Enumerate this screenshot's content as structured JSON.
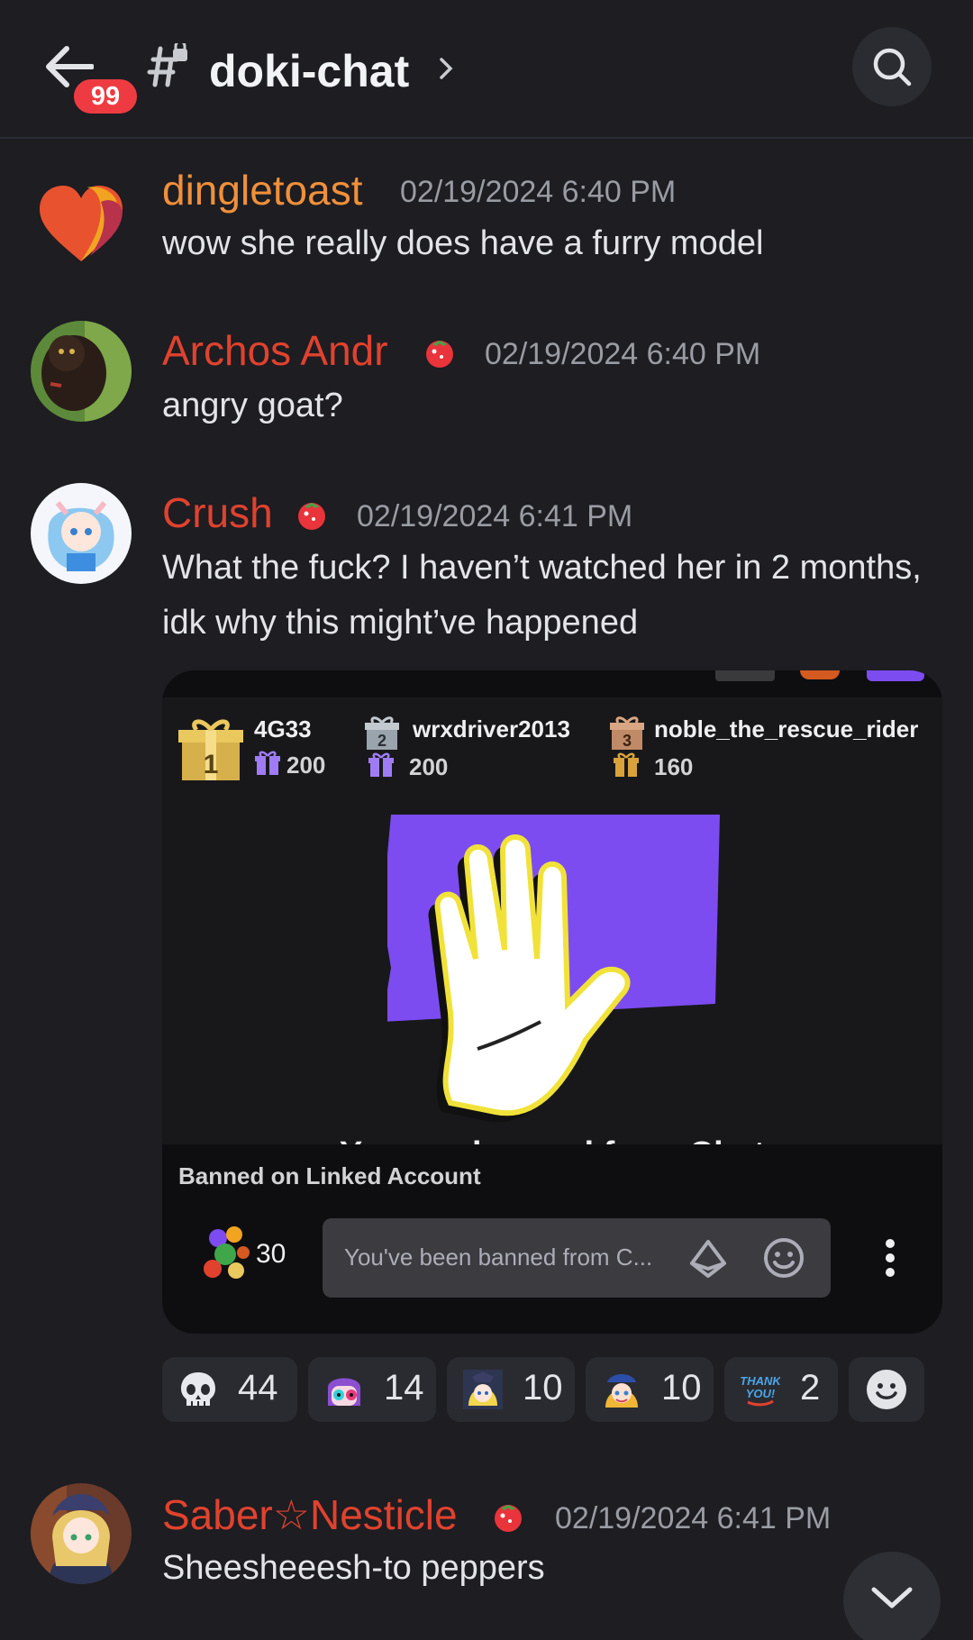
{
  "header": {
    "back_icon": "arrow-left-icon",
    "badge_count": "99",
    "channel_icon": "locked-hash-icon",
    "channel_name": "doki-chat",
    "search_icon": "search-icon"
  },
  "messages": [
    {
      "username": "dingletoast",
      "username_color": "#f0903a",
      "timestamp": "02/19/2024 6:40 PM",
      "text": "wow she really does have a furry model",
      "avatar": "heart-avatar"
    },
    {
      "username": "Archos Andr",
      "username_color": "#e0422e",
      "role_icon": "tomato-icon",
      "timestamp": "02/19/2024 6:40 PM",
      "text": "angry goat?",
      "avatar": "cat-photo-avatar"
    },
    {
      "username": "Crush",
      "username_color": "#e0422e",
      "role_icon": "tomato-icon",
      "timestamp": "02/19/2024 6:41 PM",
      "text": "What the fuck? I haven’t watched her in 2 months, idk why this might’ve happened",
      "avatar": "anime-girl-avatar",
      "attachment": {
        "gifters": [
          {
            "rank": "1",
            "name": "4G33",
            "count": "200"
          },
          {
            "rank": "2",
            "name": "wrxdriver2013",
            "count": "200"
          },
          {
            "rank": "3",
            "name": "noble_the_rescue_rider",
            "count": "160"
          }
        ],
        "ban_image": "raised-hand-ban-icon",
        "banned_title": "You are banned from Chat",
        "banned_linked": "Banned on Linked Account",
        "points": "30",
        "chat_placeholder": "You've been banned from C...",
        "accent_color": "#7c4cf0"
      }
    },
    {
      "username": "Saber☆Nesticle",
      "username_color": "#e0422e",
      "role_icon": "tomato-icon",
      "timestamp": "02/19/2024 6:41 PM",
      "text": "Sheesheeesh-to peppers",
      "avatar": "anime-knight-avatar"
    }
  ],
  "reactions": [
    {
      "emoji": "skull-emoji",
      "count": "44"
    },
    {
      "emoji": "shocked-anime-emoji",
      "count": "14"
    },
    {
      "emoji": "anime-girl-emoji",
      "count": "10"
    },
    {
      "emoji": "anime-hat-girl-emoji",
      "count": "10"
    },
    {
      "emoji": "thank-you-emoji",
      "label": "THANK YOU!",
      "count": "2"
    },
    {
      "emoji": "add-reaction-icon"
    }
  ],
  "scroll_down_icon": "chevron-down-icon"
}
